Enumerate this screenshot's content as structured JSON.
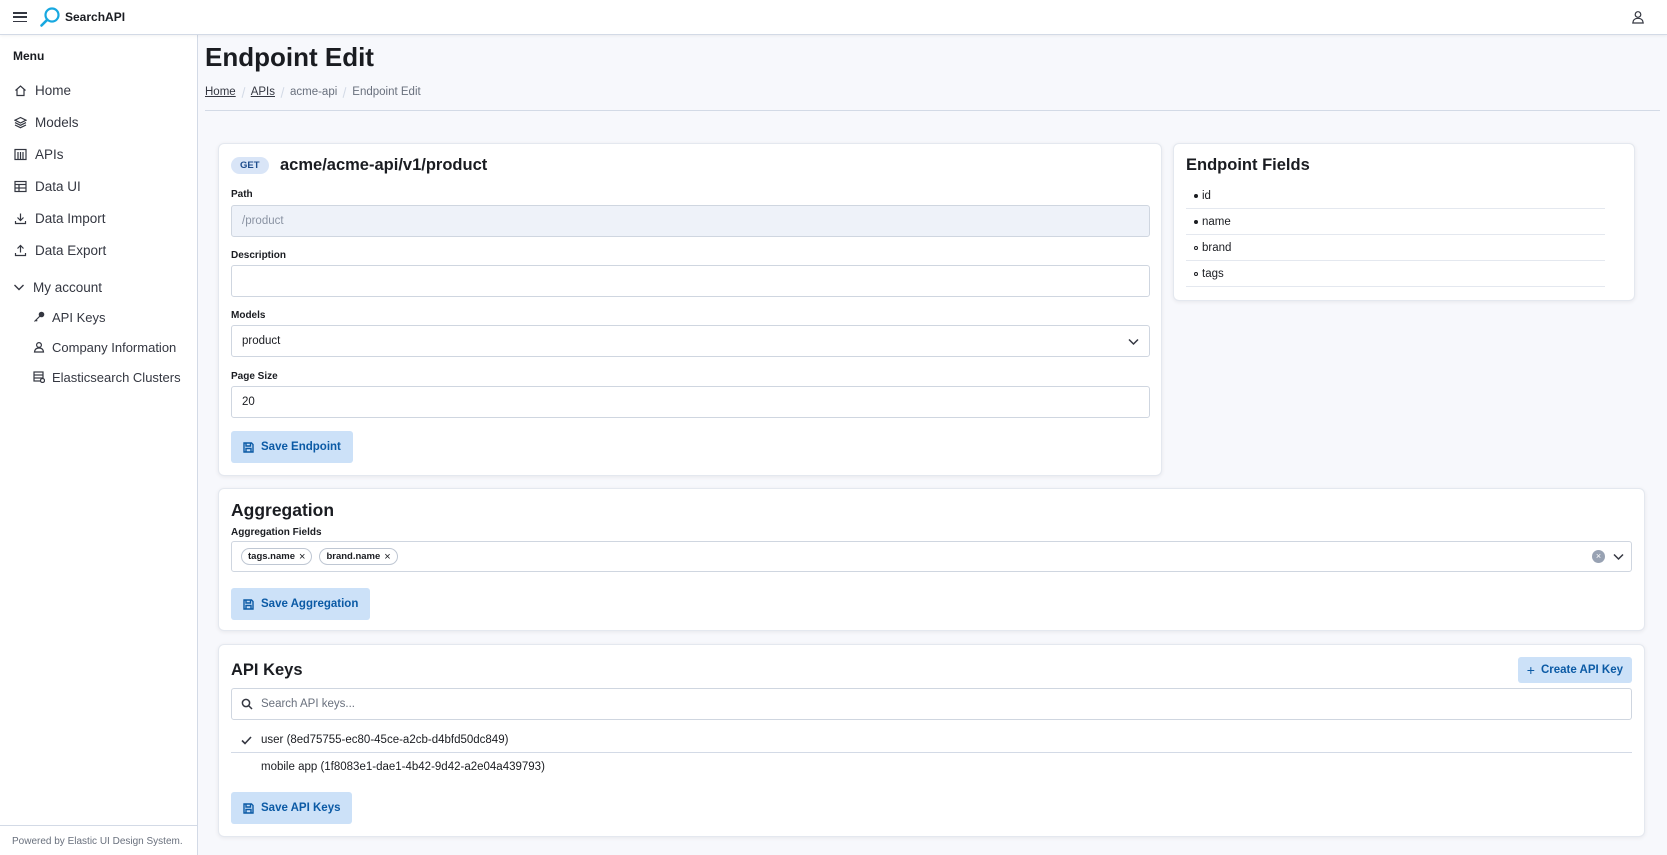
{
  "header": {
    "app_name": "SearchAPI"
  },
  "sidebar": {
    "menu_title": "Menu",
    "items": [
      {
        "label": "Home",
        "icon": "home-icon"
      },
      {
        "label": "Models",
        "icon": "layers-icon"
      },
      {
        "label": "APIs",
        "icon": "apis-icon"
      },
      {
        "label": "Data UI",
        "icon": "table-icon"
      },
      {
        "label": "Data Import",
        "icon": "download-icon"
      },
      {
        "label": "Data Export",
        "icon": "upload-icon"
      }
    ],
    "account": {
      "label": "My account",
      "items": [
        {
          "label": "API Keys",
          "icon": "key-icon"
        },
        {
          "label": "Company Information",
          "icon": "user-icon"
        },
        {
          "label": "Elasticsearch Clusters",
          "icon": "cluster-icon"
        }
      ]
    },
    "footer": "Powered by Elastic UI Design System."
  },
  "page": {
    "title": "Endpoint Edit",
    "breadcrumb": [
      "Home",
      "APIs",
      "acme-api",
      "Endpoint Edit"
    ]
  },
  "endpoint": {
    "method": "GET",
    "title": "acme/acme-api/v1/product",
    "path_label": "Path",
    "path_value": "/product",
    "description_label": "Description",
    "description_value": "",
    "models_label": "Models",
    "models_value": "product",
    "page_size_label": "Page Size",
    "page_size_value": "20",
    "save_label": "Save Endpoint"
  },
  "fields": {
    "title": "Endpoint Fields",
    "items": [
      {
        "name": "id",
        "bullet": "filled"
      },
      {
        "name": "name",
        "bullet": "filled"
      },
      {
        "name": "brand",
        "bullet": "hollow"
      },
      {
        "name": "tags",
        "bullet": "hollow"
      }
    ]
  },
  "aggregation": {
    "title": "Aggregation",
    "fields_label": "Aggregation Fields",
    "chips": [
      "tags.name",
      "brand.name"
    ],
    "save_label": "Save Aggregation"
  },
  "api_keys": {
    "title": "API Keys",
    "create_label": "Create API Key",
    "search_placeholder": "Search API keys...",
    "keys": [
      {
        "label": "user (8ed75755-ec80-45ce-a2cb-d4bfd50dc849)",
        "checked": true
      },
      {
        "label": "mobile app (1f8083e1-dae1-4b42-9d42-a2e04a439793)",
        "checked": false
      }
    ],
    "save_label": "Save API Keys"
  }
}
